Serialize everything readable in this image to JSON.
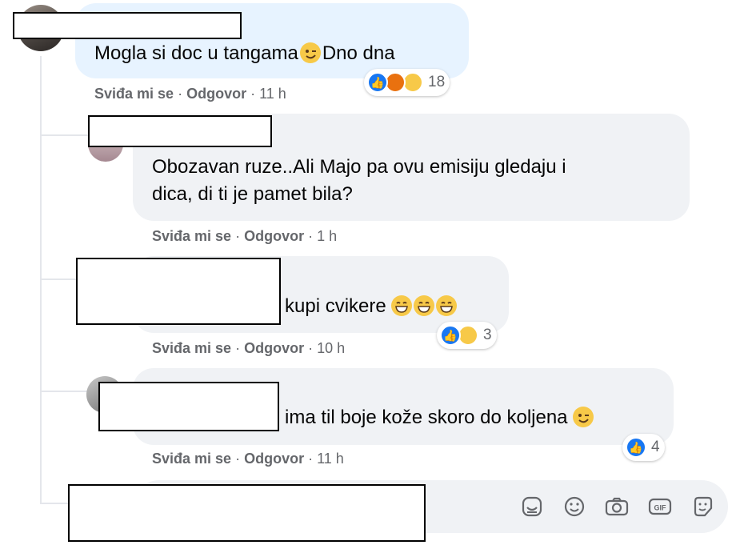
{
  "comments": [
    {
      "text_before": "Mogla si doc u tangama",
      "text_after": "Dno dna",
      "like": "Sviđa mi se",
      "reply": "Odgovor",
      "time": "11 h",
      "reaction_count": "18"
    },
    {
      "line1": "Obozavan ruze..Ali Majo pa ovu emisiju gledaju i",
      "line2": "dica, di ti je pamet bila?",
      "like": "Sviđa mi se",
      "reply": "Odgovor",
      "time": "1 h"
    },
    {
      "text": "kupi cvikere",
      "like": "Sviđa mi se",
      "reply": "Odgovor",
      "time": "10 h",
      "reaction_count": "3"
    },
    {
      "text": "ima til boje kože skoro do koljena",
      "like": "Sviđa mi se",
      "reply": "Odgovor",
      "time": "11 h",
      "reaction_count": "4"
    }
  ],
  "separator": "·",
  "reactions": {
    "c1": [
      "like-icon",
      "angry-icon",
      "haha-icon"
    ],
    "c3": [
      "like-icon",
      "haha-icon"
    ],
    "c4": [
      "like-icon"
    ]
  },
  "composer_icons": [
    "sticker-icon",
    "emoji-icon",
    "camera-icon",
    "gif-icon",
    "sticker-alt-icon"
  ],
  "colors": {
    "like_blue": "#1877f2",
    "bubble_gray": "#f0f2f5",
    "bubble_highlight": "#e7f3ff",
    "meta_gray": "#65676b"
  }
}
